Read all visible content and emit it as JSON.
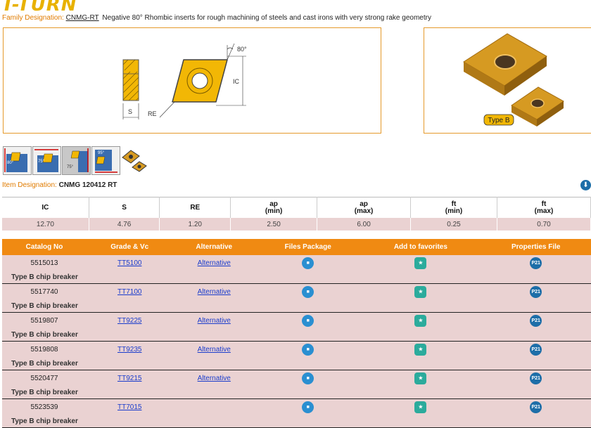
{
  "brand": {
    "logo_text": "T-TURN"
  },
  "family": {
    "label": "Family Designation:",
    "code": "CNMG-RT",
    "description": "Negative 80° Rhombic inserts for rough machining of steels and cast irons with very strong rake geometry"
  },
  "drawing": {
    "angle": "80°",
    "ic": "IC",
    "s": "S",
    "re": "RE"
  },
  "photo": {
    "badge": "Type B"
  },
  "thumbs": [
    {
      "angle": "80°",
      "name": "holder-thumb-1"
    },
    {
      "angle": "75°",
      "name": "holder-thumb-2"
    },
    {
      "angle": "75°",
      "name": "holder-thumb-3"
    },
    {
      "angle": "95°",
      "name": "holder-thumb-4"
    }
  ],
  "item": {
    "label": "Item Designation:",
    "value": "CNMG 120412 RT"
  },
  "specs": {
    "headers": [
      {
        "main": "IC",
        "sub": ""
      },
      {
        "main": "S",
        "sub": ""
      },
      {
        "main": "RE",
        "sub": ""
      },
      {
        "main": "ap",
        "sub": "(min)"
      },
      {
        "main": "ap",
        "sub": "(max)"
      },
      {
        "main": "ft",
        "sub": "(min)"
      },
      {
        "main": "ft",
        "sub": "(max)"
      }
    ],
    "values": [
      "12.70",
      "4.76",
      "1.20",
      "2.50",
      "6.00",
      "0.25",
      "0.70"
    ]
  },
  "catalog": {
    "headers": [
      "Catalog No",
      "Grade & Vc",
      "Alternative",
      "Files Package",
      "Add to favorites",
      "Properties File"
    ],
    "rows": [
      {
        "no": "5515013",
        "grade": "TT5100",
        "alt": "Alternative",
        "sub": "Type B chip breaker"
      },
      {
        "no": "5517740",
        "grade": "TT7100",
        "alt": "Alternative",
        "sub": "Type B chip breaker"
      },
      {
        "no": "5519807",
        "grade": "TT9225",
        "alt": "Alternative",
        "sub": "Type B chip breaker"
      },
      {
        "no": "5519808",
        "grade": "TT9235",
        "alt": "Alternative",
        "sub": "Type B chip breaker"
      },
      {
        "no": "5520477",
        "grade": "TT9215",
        "alt": "Alternative",
        "sub": "Type B chip breaker"
      },
      {
        "no": "5523539",
        "grade": "TT7015",
        "alt": "",
        "sub": "Type B chip breaker"
      }
    ],
    "p21_label": "P21"
  },
  "colors": {
    "accent": "#f08a12",
    "row_bg": "#ead2d2",
    "insert": "#f2b705",
    "link": "#1a3ccc"
  }
}
